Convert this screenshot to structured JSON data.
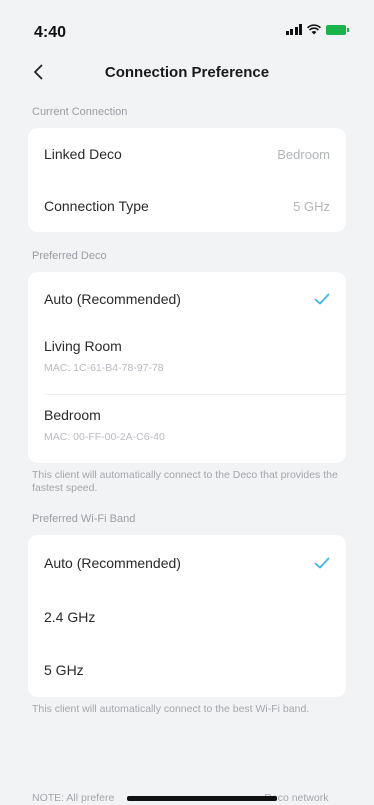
{
  "status_bar": {
    "time": "4:40"
  },
  "header": {
    "title": "Connection Preference"
  },
  "current_connection": {
    "section_label": "Current Connection",
    "rows": [
      {
        "label": "Linked Deco",
        "value": "Bedroom"
      },
      {
        "label": "Connection Type",
        "value": "5 GHz"
      }
    ]
  },
  "preferred_deco": {
    "section_label": "Preferred Deco",
    "options": [
      {
        "label": "Auto (Recommended)",
        "selected": true
      },
      {
        "label": "Living Room",
        "mac": "MAC: 1C-61-B4-78-97-78",
        "selected": false
      },
      {
        "label": "Bedroom",
        "mac": "MAC: 00-FF-00-2A-C6-40",
        "selected": false
      }
    ],
    "note": "This client will automatically connect to the Deco that provides the fastest speed."
  },
  "preferred_band": {
    "section_label": "Preferred Wi-Fi Band",
    "options": [
      {
        "label": "Auto (Recommended)",
        "selected": true
      },
      {
        "label": "2.4 GHz",
        "selected": false
      },
      {
        "label": "5 GHz",
        "selected": false
      }
    ],
    "note": "This client will automatically connect to the best Wi-Fi band."
  },
  "footer": {
    "note_start": "NOTE: All prefere",
    "note_end": "Deco network"
  },
  "colors": {
    "accent": "#3fb6e6",
    "background": "#f2f3f5",
    "card": "#ffffff"
  }
}
